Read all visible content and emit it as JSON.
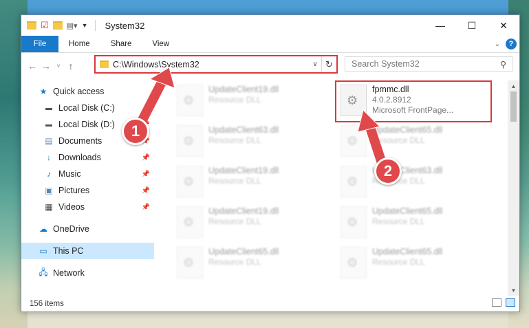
{
  "window": {
    "title": "System32"
  },
  "ribbon": {
    "tabs": [
      "File",
      "Home",
      "Share",
      "View"
    ],
    "help": "?"
  },
  "nav": {
    "address": "C:\\Windows\\System32",
    "search_placeholder": "Search System32"
  },
  "sidebar": {
    "items": [
      {
        "label": "Quick access",
        "icon": "star-icon",
        "pinned": false
      },
      {
        "label": "Local Disk (C:)",
        "icon": "drive-icon",
        "pinned": true
      },
      {
        "label": "Local Disk (D:)",
        "icon": "drive-icon",
        "pinned": true
      },
      {
        "label": "Documents",
        "icon": "documents-icon",
        "pinned": true
      },
      {
        "label": "Downloads",
        "icon": "download-icon",
        "pinned": true
      },
      {
        "label": "Music",
        "icon": "music-icon",
        "pinned": true
      },
      {
        "label": "Pictures",
        "icon": "pictures-icon",
        "pinned": true
      },
      {
        "label": "Videos",
        "icon": "videos-icon",
        "pinned": true
      },
      {
        "label": "OneDrive",
        "icon": "cloud-icon"
      },
      {
        "label": "This PC",
        "icon": "computer-icon",
        "selected": true
      },
      {
        "label": "Network",
        "icon": "network-icon"
      }
    ]
  },
  "files": {
    "highlighted": {
      "name": "fpmmc.dll",
      "version": "4.0.2.8912",
      "description": "Microsoft FrontPage..."
    },
    "others": [
      {
        "name": "UpdateClient19.dll",
        "type": "Resource DLL"
      },
      {
        "name": "UpdateClient63.dll",
        "type": "Resource DLL"
      },
      {
        "name": "UpdateClient65.dll",
        "type": "Resource DLL"
      },
      {
        "name": "UpdateClient19.dll",
        "type": "Resource DLL"
      },
      {
        "name": "UpdateClient63.dll",
        "type": "Resource DLL"
      },
      {
        "name": "UpdateClient19.dll",
        "type": "Resource DLL"
      },
      {
        "name": "UpdateClient65.dll",
        "type": "Resource DLL"
      },
      {
        "name": "UpdateClient65.dll",
        "type": "Resource DLL"
      },
      {
        "name": "UpdateClient65.dll",
        "type": "Resource DLL"
      }
    ]
  },
  "status": {
    "count": "156 items"
  },
  "annotations": {
    "badge1": "1",
    "badge2": "2"
  },
  "colors": {
    "accent": "#1979ca",
    "highlight": "#d9383c",
    "selected": "#cce8ff"
  }
}
